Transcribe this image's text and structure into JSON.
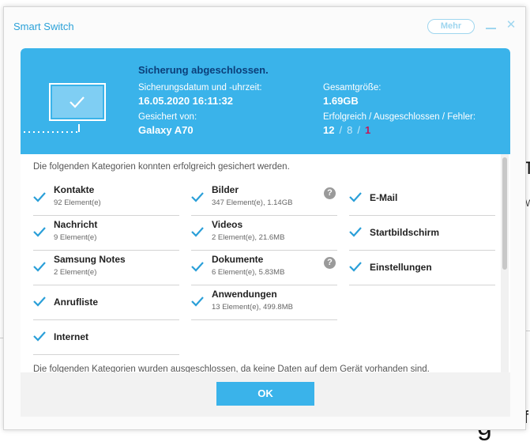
{
  "window": {
    "title": "Smart Switch",
    "more_label": "Mehr",
    "close_glyph": "✕"
  },
  "header": {
    "title": "Sicherung abgeschlossen.",
    "date_label": "Sicherungsdatum und -uhrzeit:",
    "date_value": "16.05.2020 16:11:32",
    "device_label": "Gesichert von:",
    "device_value": "Galaxy A70",
    "size_label": "Gesamtgröße:",
    "size_value": "1.69GB",
    "counts_label": "Erfolgreich / Ausgeschlossen / Fehler:",
    "success_count": "12",
    "sep": "/",
    "excluded_count": "8",
    "error_count": "1"
  },
  "content": {
    "success_intro": "Die folgenden Kategorien konnten erfolgreich gesichert werden.",
    "excluded_intro": "Die folgenden Kategorien wurden ausgeschlossen, da keine Daten auf dem Gerät vorhanden sind.",
    "items": [
      {
        "title": "Kontakte",
        "sub": "92 Element(e)"
      },
      {
        "title": "Nachricht",
        "sub": "9 Element(e)"
      },
      {
        "title": "Samsung Notes",
        "sub": "2 Element(e)"
      },
      {
        "title": "Anrufliste",
        "sub": ""
      },
      {
        "title": "Internet",
        "sub": ""
      },
      {
        "title": "Bilder",
        "sub": "347 Element(e), 1.14GB"
      },
      {
        "title": "Videos",
        "sub": "2 Element(e), 21.6MB"
      },
      {
        "title": "Dokumente",
        "sub": "6 Element(e), 5.83MB"
      },
      {
        "title": "Anwendungen",
        "sub": "13 Element(e), 499.8MB"
      },
      {
        "title": "E-Mail",
        "sub": ""
      },
      {
        "title": "Startbildschirm",
        "sub": ""
      },
      {
        "title": "Einstellungen",
        "sub": ""
      }
    ],
    "help_glyph": "?"
  },
  "footer": {
    "ok_label": "OK"
  },
  "background": {
    "frag1": "T",
    "frag2": "W",
    "frag3": "g",
    "frag4": "f"
  },
  "colors": {
    "accent": "#3ab3ea",
    "title_dark": "#0c3f7a",
    "error": "#c2185b",
    "check": "#2a9fd8"
  }
}
